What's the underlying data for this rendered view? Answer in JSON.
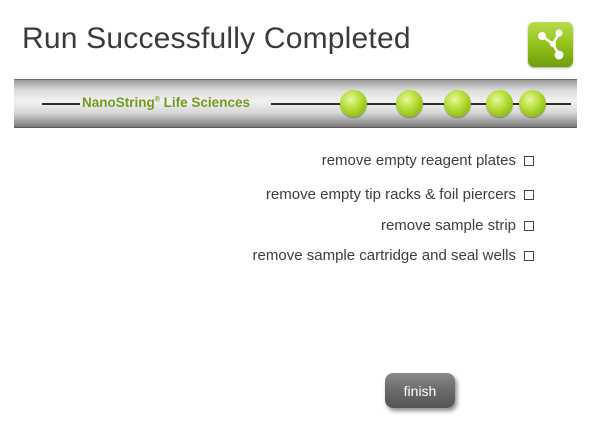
{
  "header": {
    "title": "Run Successfully Completed",
    "app_icon": "network-nodes-icon"
  },
  "band": {
    "brand_name": "NanoString",
    "brand_mark": "®",
    "brand_suffix": " Life Sciences",
    "step_dots": 5
  },
  "checklist": [
    {
      "label": "remove empty reagent plates",
      "checked": false
    },
    {
      "label": "remove empty tip racks & foil piercers",
      "checked": false
    },
    {
      "label": "remove sample strip",
      "checked": false
    },
    {
      "label": "remove sample cartridge and seal wells",
      "checked": false
    }
  ],
  "actions": {
    "finish_label": "finish"
  },
  "colors": {
    "accent_green": "#8fbf1a",
    "title_text": "#3a3a3a",
    "brand_text": "#6f9b1b"
  }
}
